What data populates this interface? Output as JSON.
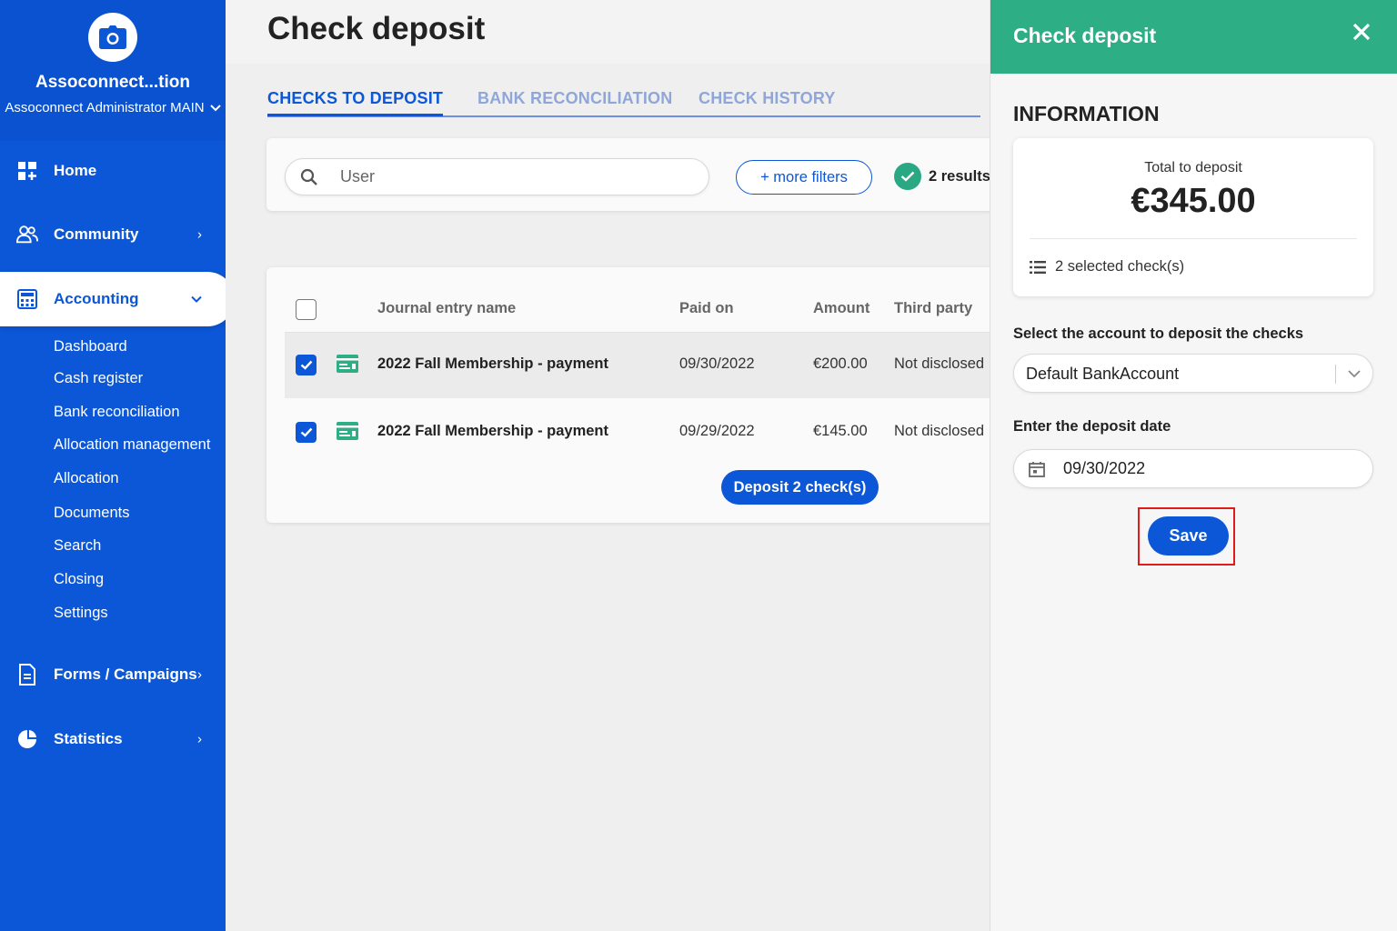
{
  "sidebar": {
    "org_name": "Assoconnect...tion",
    "user_label": "Assoconnect Administrator MAIN",
    "nav": {
      "home": "Home",
      "community": "Community",
      "accounting": "Accounting",
      "forms": "Forms / Campaigns",
      "statistics": "Statistics"
    },
    "accounting_items": [
      "Dashboard",
      "Cash register",
      "Bank reconciliation",
      "Allocation management",
      "Allocation",
      "Documents",
      "Search",
      "Closing",
      "Settings"
    ]
  },
  "main": {
    "title": "Check deposit",
    "tabs": [
      "CHECKS TO DEPOSIT",
      "BANK RECONCILIATION",
      "CHECK HISTORY"
    ],
    "search_placeholder": "User",
    "more_filters": "+ more filters",
    "results": "2 results",
    "columns": [
      "Journal entry name",
      "Paid on",
      "Amount",
      "Third party"
    ],
    "rows": [
      {
        "name": "2022 Fall Membership - payment",
        "paid_on": "09/30/2022",
        "amount": "€200.00",
        "third_party": "Not disclosed",
        "checked": true
      },
      {
        "name": "2022 Fall Membership - payment",
        "paid_on": "09/29/2022",
        "amount": "€145.00",
        "third_party": "Not disclosed",
        "checked": true
      }
    ],
    "deposit_button": "Deposit 2 check(s)"
  },
  "panel": {
    "title": "Check deposit",
    "section": "INFORMATION",
    "total_label": "Total to deposit",
    "total_value": "€345.00",
    "selected_count": "2 selected check(s)",
    "account_label": "Select the account to deposit the checks",
    "account_value": "Default BankAccount",
    "date_label": "Enter the deposit date",
    "date_value": "09/30/2022",
    "save_button": "Save"
  },
  "colors": {
    "brand_blue": "#0b57d8",
    "panel_green": "#2eae85",
    "highlight_red": "#e01b1b"
  },
  "icons": [
    "camera-icon",
    "home-icon",
    "community-icon",
    "calculator-icon",
    "form-icon",
    "pie-chart-icon",
    "search-icon",
    "check-icon",
    "bank-check-icon",
    "close-icon",
    "list-icon",
    "calendar-icon",
    "chevron-down-icon",
    "chevron-right-icon"
  ]
}
